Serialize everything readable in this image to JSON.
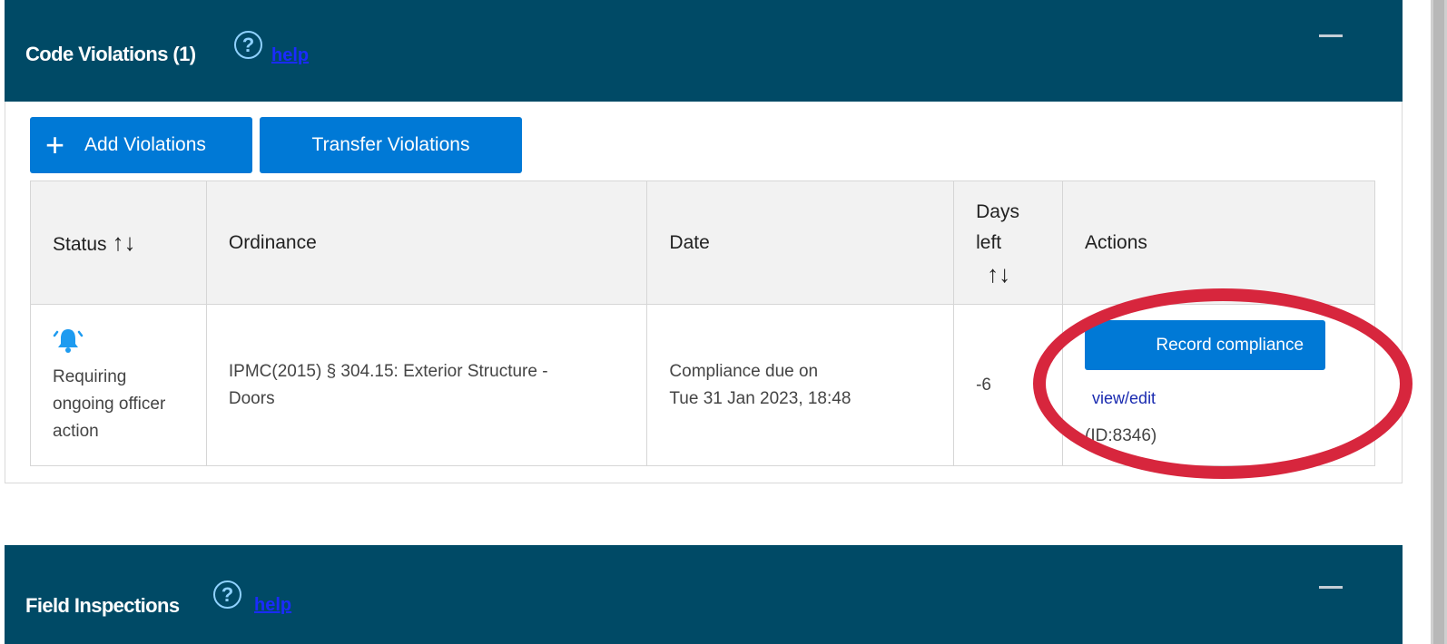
{
  "violations_panel": {
    "title": "Code Violations (1)",
    "help_icon": "?",
    "help_link": "help",
    "collapse_icon": "minus-icon"
  },
  "toolbar": {
    "add_icon": "+",
    "add_label": "Add Violations",
    "transfer_label": "Transfer Violations"
  },
  "table": {
    "headers": {
      "status": "Status",
      "ordinance": "Ordinance",
      "date": "Date",
      "days_left_line1": "Days",
      "days_left_line2": "left",
      "actions": "Actions"
    },
    "sort_icon": "↑↓",
    "rows": [
      {
        "status_icon": "bell-icon",
        "status_line1": "Requiring",
        "status_line2": "ongoing officer",
        "status_line3": "action",
        "ordinance_line1": "IPMC(2015) § 304.15: Exterior Structure -",
        "ordinance_line2": "Doors",
        "date_line1": "Compliance due on",
        "date_line2": "Tue 31 Jan 2023, 18:48",
        "days_left": "-6",
        "record_label": "Record compliance",
        "view_edit_label": "view/edit",
        "id_label": "(ID:8346)"
      }
    ]
  },
  "inspections_panel": {
    "title": "Field Inspections",
    "help_icon": "?",
    "help_link": "help",
    "collapse_icon": "minus-icon"
  },
  "colors": {
    "header_bg": "#004a66",
    "primary_button": "#0079d6",
    "due_text": "#f7a12a",
    "annotation_red": "#d7263d"
  }
}
